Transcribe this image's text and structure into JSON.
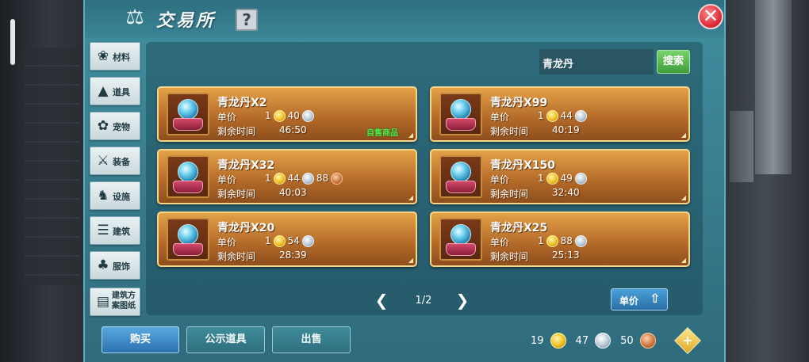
{
  "header": {
    "title": "交易所",
    "help_label": "?",
    "close_label": "✕"
  },
  "categories": [
    {
      "label": "材料",
      "icon": "materials-icon",
      "glyph": "❀"
    },
    {
      "label": "道具",
      "icon": "flask-icon",
      "glyph": "▲"
    },
    {
      "label": "宠物",
      "icon": "paw-icon",
      "glyph": "✿"
    },
    {
      "label": "装备",
      "icon": "sword-icon",
      "glyph": "⚔"
    },
    {
      "label": "设施",
      "icon": "facility-icon",
      "glyph": "♞"
    },
    {
      "label": "建筑",
      "icon": "building-icon",
      "glyph": "☰"
    },
    {
      "label": "服饰",
      "icon": "clothing-icon",
      "glyph": "♣"
    },
    {
      "label": "建筑方案图纸",
      "icon": "blueprint-icon",
      "glyph": "▤"
    }
  ],
  "search": {
    "value": "青龙丹",
    "button_label": "搜索"
  },
  "listing_labels": {
    "unit_price": "单价",
    "time_left": "剩余时间",
    "own_tag": "自售商品"
  },
  "listings": [
    {
      "name": "青龙丹X2",
      "gold": "1",
      "silver": "40",
      "copper": "",
      "time": "46:50",
      "own": true
    },
    {
      "name": "青龙丹X99",
      "gold": "1",
      "silver": "44",
      "copper": "",
      "time": "40:19",
      "own": false
    },
    {
      "name": "青龙丹X32",
      "gold": "1",
      "silver": "44",
      "copper": "88",
      "time": "40:03",
      "own": false
    },
    {
      "name": "青龙丹X150",
      "gold": "1",
      "silver": "49",
      "copper": "",
      "time": "32:40",
      "own": false
    },
    {
      "name": "青龙丹X20",
      "gold": "1",
      "silver": "54",
      "copper": "",
      "time": "28:39",
      "own": false
    },
    {
      "name": "青龙丹X25",
      "gold": "1",
      "silver": "88",
      "copper": "",
      "time": "25:13",
      "own": false
    }
  ],
  "pager": {
    "label": "1/2",
    "prev": "❮",
    "next": "❯"
  },
  "sort": {
    "label": "单价",
    "arrow": "⇧"
  },
  "actions": {
    "buy": "购买",
    "show": "公示道具",
    "sell": "出售"
  },
  "currency": {
    "gold": "19",
    "silver": "47",
    "copper": "50",
    "add": "+"
  },
  "colors": {
    "panel": "#3a7f90",
    "card": "#b66d2a",
    "search_button": "#4aa845",
    "buy_button": "#2b71b0",
    "own_tag": "#52e84c",
    "close": "#e0303c"
  }
}
